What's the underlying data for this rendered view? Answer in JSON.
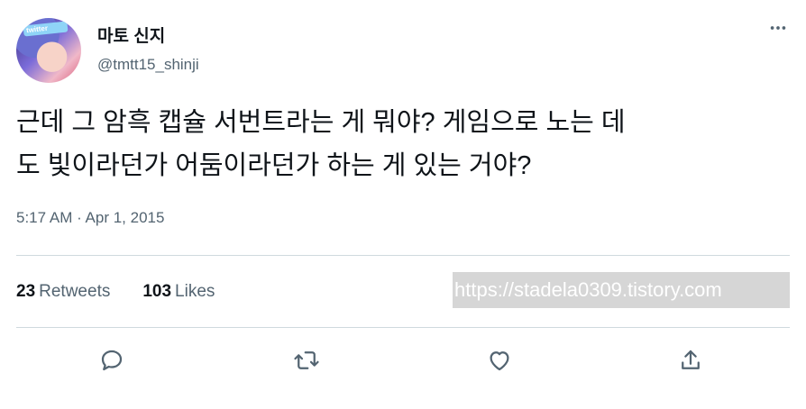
{
  "user": {
    "display_name": "마토 신지",
    "handle": "@tmtt15_shinji",
    "avatar_badge": "twitter"
  },
  "tweet": {
    "text": "근데 그 암흑 캡슐 서번트라는 게 뭐야? 게임으로 노는 데\n도 빛이라던가 어둠이라던가 하는 게 있는 거야?",
    "timestamp": "5:17 AM · Apr 1, 2015"
  },
  "stats": {
    "retweets_count": "23",
    "retweets_label": "Retweets",
    "likes_count": "103",
    "likes_label": "Likes"
  },
  "watermark": "https://stadela0309.tistory.com",
  "icons": {
    "more": "more-horizontal-icon",
    "reply": "reply-icon",
    "retweet": "retweet-icon",
    "like": "like-icon",
    "share": "share-icon"
  },
  "colors": {
    "text": "#0f1419",
    "secondary": "#536471",
    "divider": "#cfd9de"
  }
}
